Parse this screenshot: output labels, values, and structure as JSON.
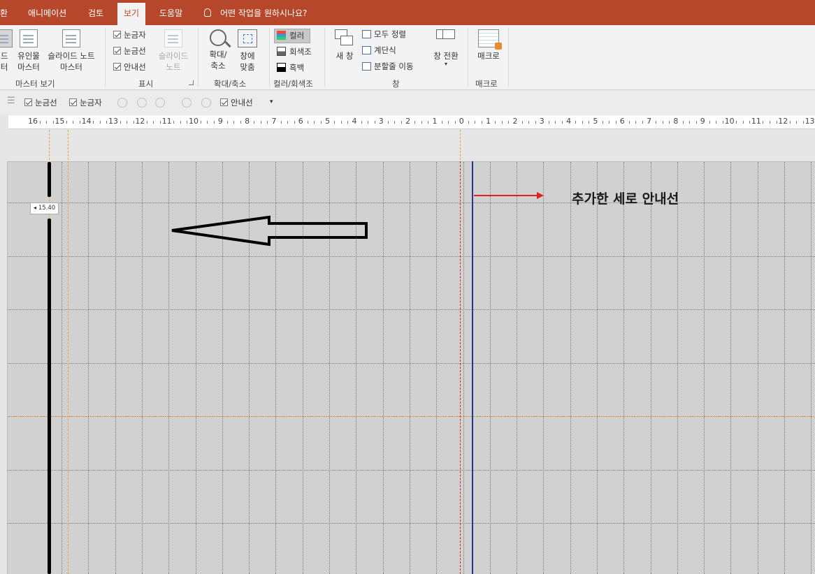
{
  "tabs": [
    {
      "label": "환",
      "active": false
    },
    {
      "label": "애니메이션",
      "active": false
    },
    {
      "label": "검토",
      "active": false
    },
    {
      "label": "보기",
      "active": true
    },
    {
      "label": "도움말",
      "active": false
    }
  ],
  "tell_me": "어떤 작업을 원하시나요?",
  "ribbon": {
    "master_views": {
      "label": "마스터 보기",
      "slide_master_partial": [
        "이드",
        "터"
      ],
      "handout_master": [
        "유인물",
        "마스터"
      ],
      "notes_master": [
        "슬라이드 노트",
        "마스터"
      ]
    },
    "show": {
      "label": "표시",
      "ruler": "눈금자",
      "gridlines": "눈금선",
      "guides": "안내선",
      "notes": [
        "슬라이드",
        "노트"
      ]
    },
    "zoom": {
      "label": "확대/축소",
      "zoom": [
        "확대/",
        "축소"
      ],
      "fit": [
        "창에",
        "맞춤"
      ]
    },
    "color": {
      "label": "컬러/회색조",
      "color": "컬러",
      "grayscale": "회색조",
      "bw": "흑백"
    },
    "window": {
      "label": "창",
      "new_window": "새 창",
      "arrange_all": "모두 정렬",
      "cascade": "계단식",
      "move_split": "분할줄 이동",
      "switch": "창 전환"
    },
    "macros": {
      "label": "매크로",
      "macros": "매크로"
    }
  },
  "qat": {
    "gridlines": "눈금선",
    "ruler": "눈금자",
    "guides": "안내선"
  },
  "ruler_numbers": [
    "16",
    "15",
    "14",
    "13",
    "12",
    "11",
    "10",
    "9",
    "8",
    "7",
    "6",
    "5",
    "4",
    "3",
    "2",
    "1",
    "0",
    "1",
    "2",
    "3",
    "4",
    "5",
    "6",
    "7",
    "8",
    "9",
    "10",
    "11",
    "12",
    "13"
  ],
  "guide_tooltip": "15.40",
  "annotation": "추가한 세로 안내선",
  "colors": {
    "tab_bar": "#b7472a",
    "red_guide": "#e02020",
    "blue_guide": "#1f3a8a",
    "orange_guide": "#f0a030"
  }
}
